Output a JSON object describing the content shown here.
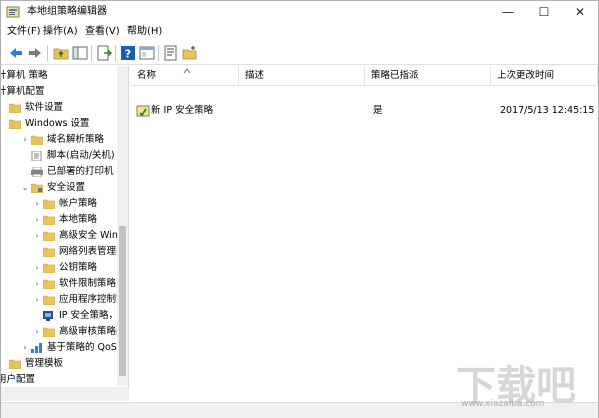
{
  "window": {
    "title": "本地组策略编辑器",
    "minimize": "—",
    "maximize": "☐",
    "close": "✕"
  },
  "menu": [
    "文件(F)",
    "操作(A)",
    "查看(V)",
    "帮助(H)"
  ],
  "toolbar": {
    "icons": [
      "back-arrow-icon",
      "forward-arrow-icon",
      "up-folder-icon",
      "show-hide-tree-icon",
      "export-list-icon",
      "help-icon",
      "properties-icon",
      "filter-icon",
      "new-item-icon"
    ]
  },
  "tree": [
    {
      "label": "计算机 策略",
      "indent": 0
    },
    {
      "label": "计算机配置",
      "indent": 0
    },
    {
      "label": "软件设置",
      "indent": 1
    },
    {
      "label": "Windows 设置",
      "indent": 1
    },
    {
      "label": "域名解析策略",
      "indent": 2
    },
    {
      "label": "脚本(启动/关机)",
      "indent": 2
    },
    {
      "label": "已部署的打印机",
      "indent": 2
    },
    {
      "label": "安全设置",
      "indent": 2
    },
    {
      "label": "帐户策略",
      "indent": 3
    },
    {
      "label": "本地策略",
      "indent": 3
    },
    {
      "label": "高级安全 Wind",
      "indent": 3
    },
    {
      "label": "网络列表管理器",
      "indent": 3
    },
    {
      "label": "公钥策略",
      "indent": 3
    },
    {
      "label": "软件限制策略",
      "indent": 3
    },
    {
      "label": "应用程序控制策",
      "indent": 3
    },
    {
      "label": "IP 安全策略，在",
      "indent": 3
    },
    {
      "label": "高级审核策略配",
      "indent": 3
    },
    {
      "label": "基于策略的 QoS",
      "indent": 2
    },
    {
      "label": "管理模板",
      "indent": 1
    },
    {
      "label": "用户配置",
      "indent": 0
    }
  ],
  "list": {
    "columns": [
      "名称",
      "描述",
      "策略已指派",
      "上次更改时间"
    ],
    "rows": [
      {
        "name": "新 IP 安全策略",
        "description": "",
        "assigned": "是",
        "modified": "2017/5/13 12:45:15"
      }
    ]
  },
  "watermark": {
    "text": "下载吧",
    "url": "www.xiazaiba.com"
  },
  "colors": {
    "folder": "#e8c25a",
    "folder_dark": "#c9a13a",
    "selected_row": "#cce8ff",
    "accent_blue": "#1a5fb4"
  }
}
